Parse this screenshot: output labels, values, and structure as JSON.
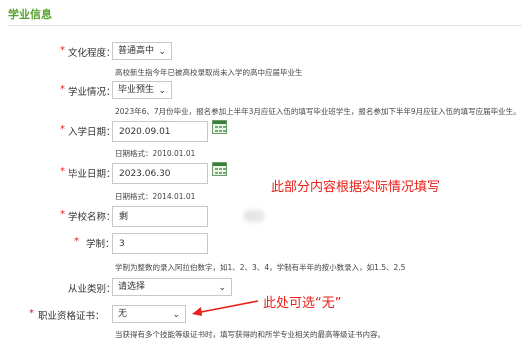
{
  "section": {
    "title": "学业信息"
  },
  "form": {
    "education_level": {
      "label": "文化程度：",
      "value": "普通高中",
      "hint": "高校新生指今年已被高校录取尚未入学的高中应届毕业生"
    },
    "study_status": {
      "label": "学业情况：",
      "value": "毕业预生",
      "hint": "2023年6、7月份毕业，报名参加上半年3月应征入伍的填写毕业班学生，报名参加下半年9月应征入伍的填写应届毕业生。"
    },
    "enroll_date": {
      "label": "入学日期：",
      "value": "2020.09.01",
      "hint": "日期格式：2010.01.01"
    },
    "grad_date": {
      "label": "毕业日期：",
      "value": "2023.06.30",
      "hint": "日期格式：2014.01.01"
    },
    "school_name": {
      "label": "学校名称：",
      "value": "剩"
    },
    "duration": {
      "label": "学制：",
      "value": "3",
      "hint": "学制为整数的录入阿拉伯数字，如1、2、3、4，学制有半年的按小数录入，如1.5、2.5"
    },
    "industry": {
      "label": "从业类别：",
      "value": "请选择"
    },
    "certificate": {
      "label": "职业资格证书：",
      "value": "无",
      "hint": "当获得有多个技能等级证书时，填写获得的和所学专业相关的最高等级证书内容。"
    }
  },
  "annotations": {
    "fill_note": "此部分内容根据实际情况填写",
    "none_note": "此处可选“无”"
  },
  "colors": {
    "title": "#5aa033",
    "required": "#e02020",
    "annotation": "#e8201a"
  }
}
